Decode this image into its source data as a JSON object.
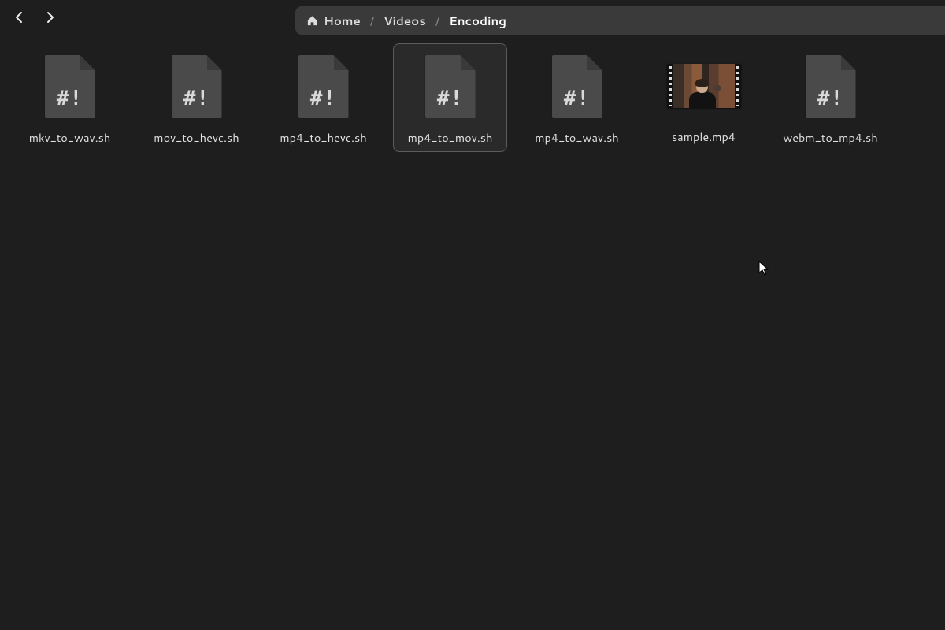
{
  "breadcrumb": {
    "home": "Home",
    "videos": "Videos",
    "current": "Encoding"
  },
  "files": [
    {
      "name": "mkv_to_wav.sh",
      "type": "shell",
      "selected": false
    },
    {
      "name": "mov_to_hevc.sh",
      "type": "shell",
      "selected": false
    },
    {
      "name": "mp4_to_hevc.sh",
      "type": "shell",
      "selected": false
    },
    {
      "name": "mp4_to_mov.sh",
      "type": "shell",
      "selected": true
    },
    {
      "name": "mp4_to_wav.sh",
      "type": "shell",
      "selected": false
    },
    {
      "name": "sample.mp4",
      "type": "video",
      "selected": false
    },
    {
      "name": "webm_to_mp4.sh",
      "type": "shell",
      "selected": false
    }
  ],
  "shell_icon_text": "#!"
}
